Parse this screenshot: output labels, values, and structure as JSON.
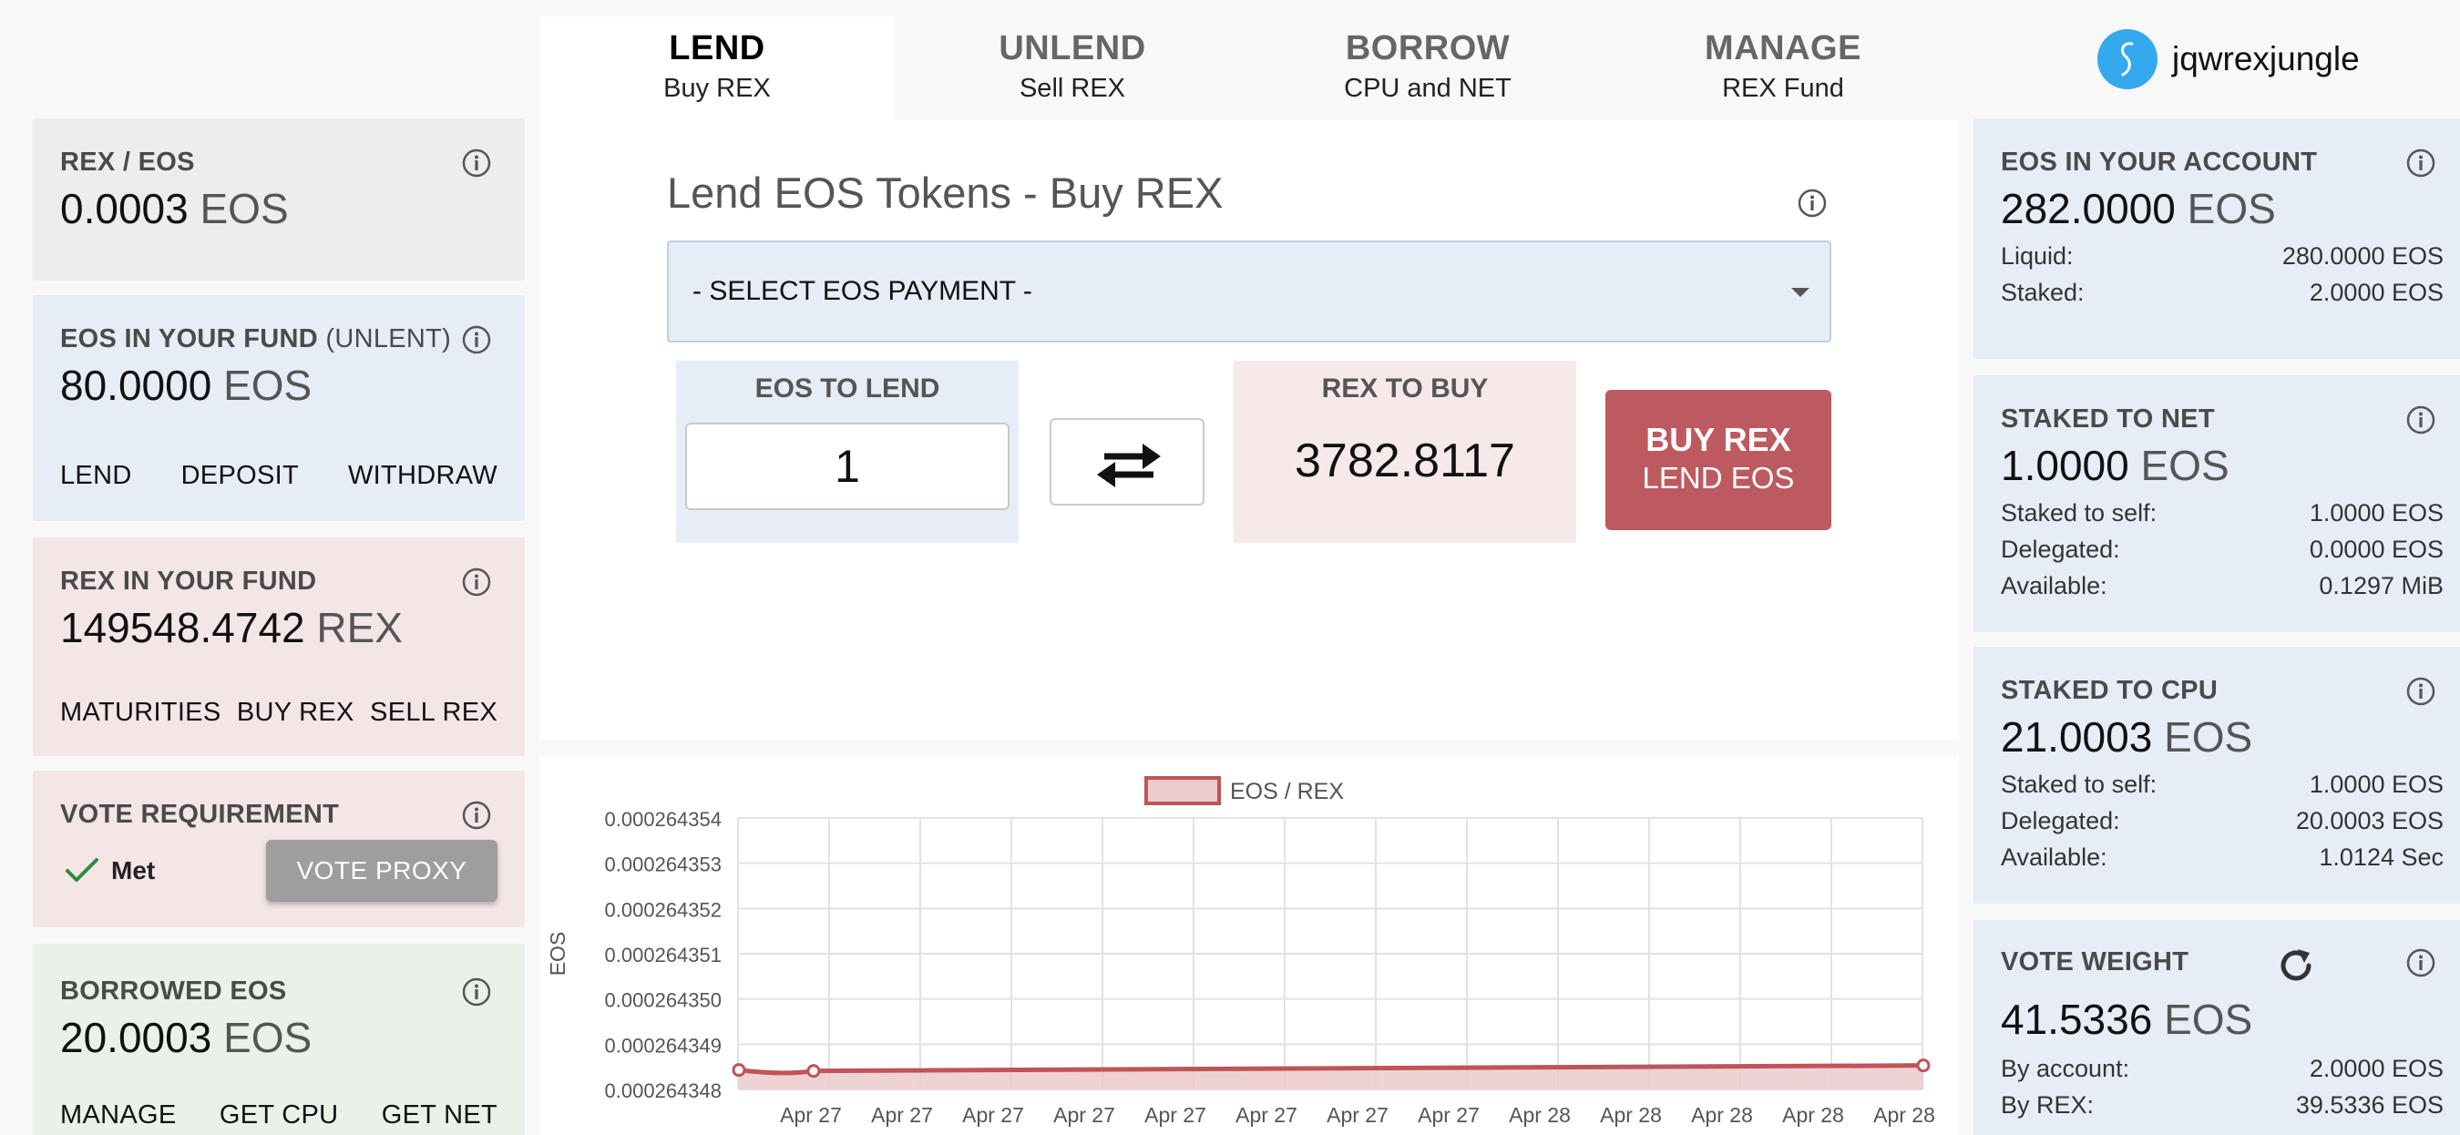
{
  "tabs": [
    {
      "title": "LEND",
      "sub": "Buy REX"
    },
    {
      "title": "UNLEND",
      "sub": "Sell REX"
    },
    {
      "title": "BORROW",
      "sub": "CPU and NET"
    },
    {
      "title": "MANAGE",
      "sub": "REX Fund"
    }
  ],
  "user": {
    "name": "jqwrexjungle"
  },
  "left": {
    "rex_eos": {
      "title": "REX / EOS",
      "value": "0.0003",
      "unit": "EOS"
    },
    "eos_fund": {
      "title": "EOS IN YOUR FUND",
      "title_suffix": "(UNLENT)",
      "value": "80.0000",
      "unit": "EOS",
      "actions": [
        "LEND",
        "DEPOSIT",
        "WITHDRAW"
      ]
    },
    "rex_fund": {
      "title": "REX IN YOUR FUND",
      "value": "149548.4742",
      "unit": "REX",
      "actions": [
        "MATURITIES",
        "BUY REX",
        "SELL REX"
      ]
    },
    "vote_req": {
      "title": "VOTE REQUIREMENT",
      "status": "Met",
      "button": "VOTE PROXY"
    },
    "borrowed": {
      "title": "BORROWED EOS",
      "value": "20.0003",
      "unit": "EOS",
      "actions": [
        "MANAGE",
        "GET CPU",
        "GET NET"
      ]
    }
  },
  "center": {
    "heading": "Lend EOS Tokens - Buy REX",
    "select_placeholder": "- SELECT EOS PAYMENT -",
    "lend_label": "EOS TO LEND",
    "lend_value": "1",
    "rex_label": "REX TO BUY",
    "rex_value": "3782.8117",
    "buy_l1": "BUY REX",
    "buy_l2": "LEND EOS"
  },
  "right": {
    "account": {
      "title": "EOS IN YOUR ACCOUNT",
      "value": "282.0000",
      "unit": "EOS",
      "rows": [
        {
          "k": "Liquid:",
          "v": "280.0000 EOS"
        },
        {
          "k": "Staked:",
          "v": "2.0000 EOS"
        }
      ]
    },
    "net": {
      "title": "STAKED TO NET",
      "value": "1.0000",
      "unit": "EOS",
      "rows": [
        {
          "k": "Staked to self:",
          "v": "1.0000 EOS"
        },
        {
          "k": "Delegated:",
          "v": "0.0000 EOS"
        },
        {
          "k": "Available:",
          "v": "0.1297 MiB"
        }
      ]
    },
    "cpu": {
      "title": "STAKED TO CPU",
      "value": "21.0003",
      "unit": "EOS",
      "rows": [
        {
          "k": "Staked to self:",
          "v": "1.0000 EOS"
        },
        {
          "k": "Delegated:",
          "v": "20.0003 EOS"
        },
        {
          "k": "Available:",
          "v": "1.0124 Sec"
        }
      ]
    },
    "vote_weight": {
      "title": "VOTE WEIGHT",
      "value": "41.5336",
      "unit": "EOS",
      "rows": [
        {
          "k": "By account:",
          "v": "2.0000 EOS"
        },
        {
          "k": "By REX:",
          "v": "39.5336 EOS"
        }
      ]
    }
  },
  "colors": {
    "accent_red": "#bd5a5f",
    "line": "#bf5459",
    "fill": "#ebcbcd",
    "check": "#2e8b3a"
  },
  "chart_data": {
    "type": "line",
    "series": [
      {
        "name": "EOS / REX",
        "values": [
          0.00026434843,
          0.00026434841,
          0.00026434842,
          0.00026434853
        ]
      }
    ],
    "x": [
      "Apr 27",
      "Apr 27",
      "Apr 27",
      "Apr 28"
    ],
    "x_ticks": [
      "Apr 27",
      "Apr 27",
      "Apr 27",
      "Apr 27",
      "Apr 27",
      "Apr 27",
      "Apr 27",
      "Apr 27",
      "Apr 28",
      "Apr 28",
      "Apr 28",
      "Apr 28",
      "Apr 28"
    ],
    "y_ticks": [
      "0.000264354",
      "0.000264353",
      "0.000264352",
      "0.000264351",
      "0.000264350",
      "0.000264349",
      "0.000264348"
    ],
    "ylabel": "EOS",
    "ylim": [
      0.000264348,
      0.000264354
    ],
    "legend": "top",
    "grid": true
  }
}
